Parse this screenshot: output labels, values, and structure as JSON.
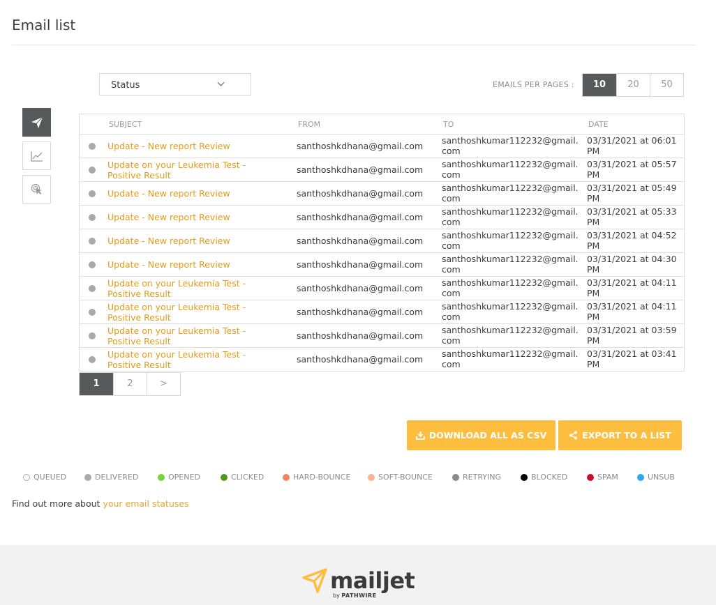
{
  "page": {
    "title": "Email list"
  },
  "filter": {
    "status_value": "Status"
  },
  "per_page": {
    "label": "EMAILS PER PAGES :",
    "options": [
      "10",
      "20",
      "50"
    ],
    "selected": "10"
  },
  "side_nav": [
    "send-icon",
    "chart-icon",
    "click-icon"
  ],
  "table": {
    "headers": {
      "subject": "SUBJECT",
      "from": "FROM",
      "to": "TO",
      "date": "DATE"
    },
    "rows": [
      {
        "subject": "Update - New report Review",
        "from": "santhoshkdhana@gmail.com",
        "to": "santhoshkumar112232@gmail.com",
        "date": "03/31/2021 at 06:01 PM"
      },
      {
        "subject": "Update on your Leukemia Test - Positive Result",
        "from": "santhoshkdhana@gmail.com",
        "to": "santhoshkumar112232@gmail.com",
        "date": "03/31/2021 at 05:57 PM"
      },
      {
        "subject": "Update - New report Review",
        "from": "santhoshkdhana@gmail.com",
        "to": "santhoshkumar112232@gmail.com",
        "date": "03/31/2021 at 05:49 PM"
      },
      {
        "subject": "Update - New report Review",
        "from": "santhoshkdhana@gmail.com",
        "to": "santhoshkumar112232@gmail.com",
        "date": "03/31/2021 at 05:33 PM"
      },
      {
        "subject": "Update - New report Review",
        "from": "santhoshkdhana@gmail.com",
        "to": "santhoshkumar112232@gmail.com",
        "date": "03/31/2021 at 04:52 PM"
      },
      {
        "subject": "Update - New report Review",
        "from": "santhoshkdhana@gmail.com",
        "to": "santhoshkumar112232@gmail.com",
        "date": "03/31/2021 at 04:30 PM"
      },
      {
        "subject": "Update on your Leukemia Test - Positive Result",
        "from": "santhoshkdhana@gmail.com",
        "to": "santhoshkumar112232@gmail.com",
        "date": "03/31/2021 at 04:11 PM"
      },
      {
        "subject": "Update on your Leukemia Test - Positive Result",
        "from": "santhoshkdhana@gmail.com",
        "to": "santhoshkumar112232@gmail.com",
        "date": "03/31/2021 at 04:11 PM"
      },
      {
        "subject": "Update on your Leukemia Test - Positive Result",
        "from": "santhoshkdhana@gmail.com",
        "to": "santhoshkumar112232@gmail.com",
        "date": "03/31/2021 at 03:59 PM"
      },
      {
        "subject": "Update on your Leukemia Test - Positive Result",
        "from": "santhoshkdhana@gmail.com",
        "to": "santhoshkumar112232@gmail.com",
        "date": "03/31/2021 at 03:41 PM"
      }
    ]
  },
  "pagination": {
    "pages": [
      "1",
      "2",
      ">"
    ],
    "current": "1"
  },
  "actions": {
    "download_label": "DOWNLOAD ALL AS CSV",
    "export_label": "EXPORT TO A LIST",
    "color": "#fdbd3e"
  },
  "legend": [
    {
      "label": "QUEUED",
      "color": "#ffffff",
      "outline": true
    },
    {
      "label": "DELIVERED",
      "color": "#a9a9a9"
    },
    {
      "label": "OPENED",
      "color": "#7ad33b"
    },
    {
      "label": "CLICKED",
      "color": "#4e9a1a"
    },
    {
      "label": "HARD-BOUNCE",
      "color": "#f4845f"
    },
    {
      "label": "SOFT-BOUNCE",
      "color": "#f7b497"
    },
    {
      "label": "RETRYING",
      "color": "#8a8a8a"
    },
    {
      "label": "BLOCKED",
      "color": "#000000"
    },
    {
      "label": "SPAM",
      "color": "#c8102e"
    },
    {
      "label": "UNSUB",
      "color": "#2aa9e8"
    }
  ],
  "findout": {
    "text": "Find out more about",
    "link": "your email statuses"
  },
  "footer": {
    "brand": "mailjet",
    "by": "by",
    "company": "PATHWIRE"
  }
}
